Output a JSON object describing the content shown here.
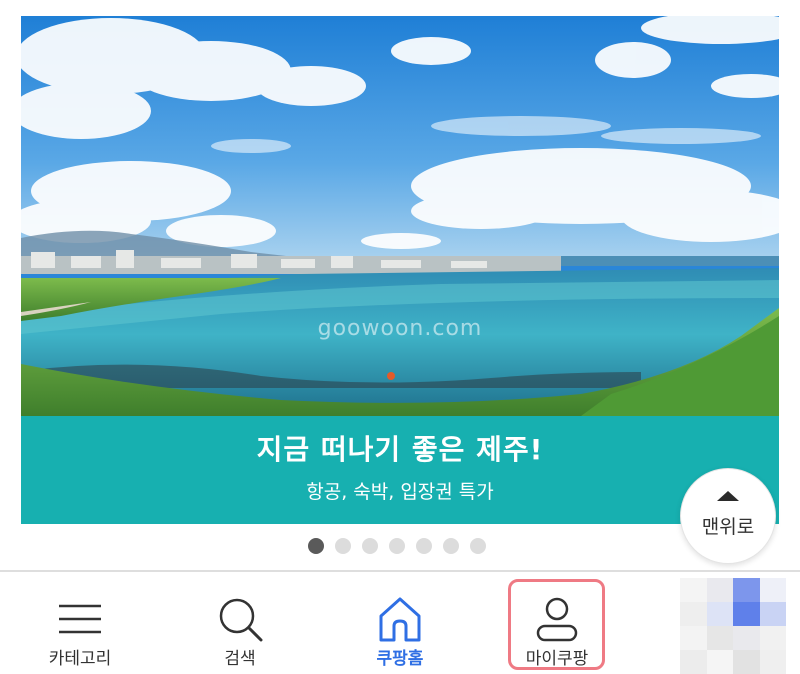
{
  "banner": {
    "watermark": "goowoon.com",
    "title": "지금 떠나기 좋은 제주!",
    "subtitle": "항공, 숙박, 입장권 특가",
    "caption_color": "#17b0b0",
    "slide_count": 7,
    "active_slide": 1
  },
  "top_button": {
    "label": "맨위로",
    "icon": "caret-up-icon"
  },
  "bottom_nav": {
    "active_color": "#2f6fe4",
    "highlight_color": "#ef7a84",
    "items": [
      {
        "label": "카테고리",
        "icon": "menu-icon"
      },
      {
        "label": "검색",
        "icon": "search-icon"
      },
      {
        "label": "쿠팡홈",
        "icon": "home-icon",
        "active": true
      },
      {
        "label": "마이쿠팡",
        "icon": "user-icon",
        "highlighted": true
      }
    ]
  },
  "thumbnail": {
    "tile_colors": [
      "#f4f4f4",
      "#e9e9ee",
      "#7d96ec",
      "#eef0f8",
      "#eeeeee",
      "#dde3f6",
      "#5f80ea",
      "#c9d3f4",
      "#f3f3f3",
      "#e6e6e6",
      "#e9e9ed",
      "#f1f1f1",
      "#ececec",
      "#f5f5f5",
      "#e2e2e2",
      "#efefef"
    ]
  }
}
